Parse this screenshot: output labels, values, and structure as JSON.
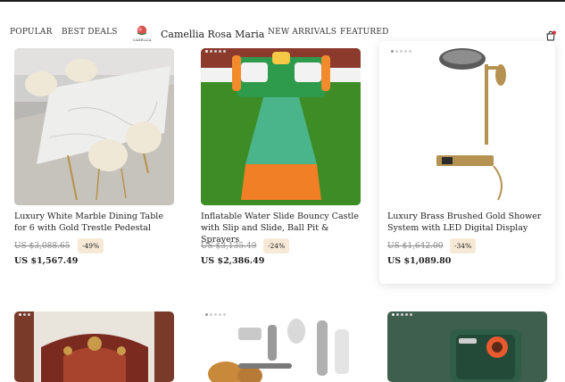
{
  "nav": {
    "popular": "POPULAR",
    "best_deals": "BEST DEALS",
    "brand_name": "Camellia Rosa Maria",
    "brand_logo_text": "CAMELLIA",
    "new_arrivals": "NEW ARRIVALS",
    "featured": "FEATURED",
    "cart_icon": "shopping-bag-icon"
  },
  "products": [
    {
      "title": "Luxury White Marble Dining Table for 6 with Gold Trestle Pedestal",
      "old_price": "US $3,088.65",
      "discount": "-49%",
      "price": "US $1,567.49"
    },
    {
      "title": "Inflatable Water Slide Bouncy Castle with Slip and Slide, Ball Pit & Sprayers",
      "old_price": "US $3,135.49",
      "discount": "-24%",
      "price": "US $2,386.49"
    },
    {
      "title": "Luxury Brass Brushed Gold Shower System with LED Digital Display",
      "old_price": "US $1,642.00",
      "discount": "-34%",
      "price": "US $1,089.80"
    }
  ],
  "colors": {
    "badge_bg": "#f6ead6",
    "cart_dot": "#e0353d"
  }
}
